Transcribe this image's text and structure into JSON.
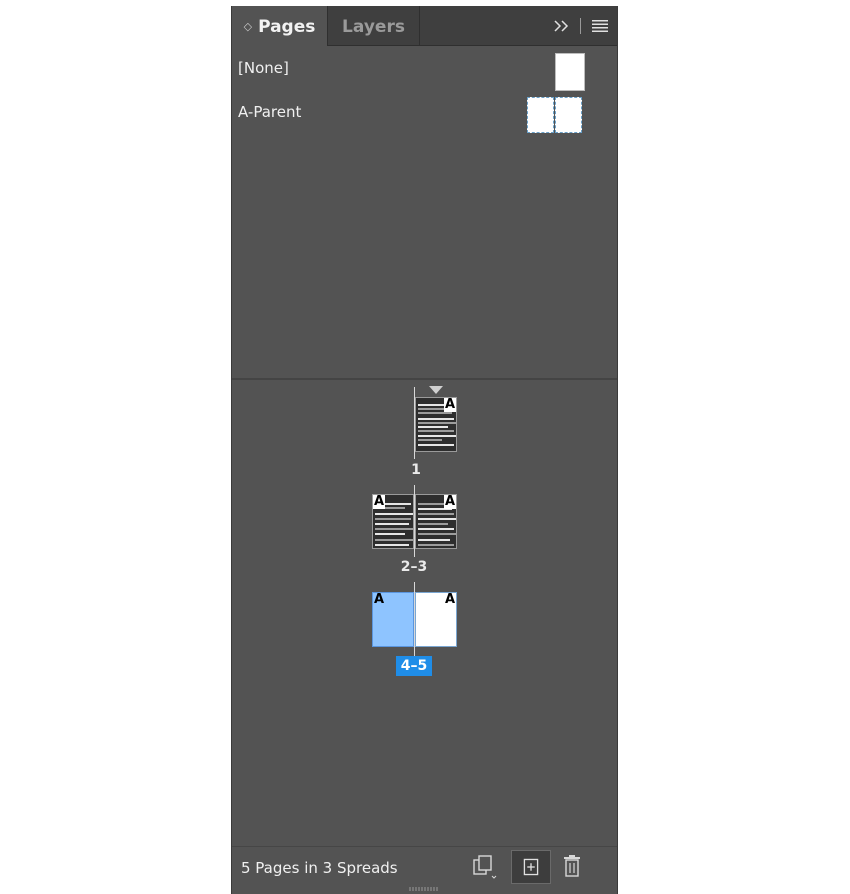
{
  "tabs": {
    "pages_label": "Pages",
    "layers_label": "Layers"
  },
  "parents": [
    {
      "name": "[None]"
    },
    {
      "name": "A-Parent"
    }
  ],
  "spreads": [
    {
      "label": "1",
      "parent_letter": "A"
    },
    {
      "label": "2–3",
      "parent_letter": "A"
    },
    {
      "label": "4–5",
      "parent_letter": "A",
      "selected": true
    }
  ],
  "footer": {
    "status": "5 Pages in 3 Spreads"
  },
  "colors": {
    "panel_bg": "#535353",
    "tab_bar": "#3f3f3f",
    "selection": "#1f8de8",
    "selected_page": "#8ec4ff"
  },
  "icons": [
    "collapse-panel-icon",
    "panel-menu-icon",
    "edit-page-size-icon",
    "new-page-icon",
    "trash-icon"
  ]
}
